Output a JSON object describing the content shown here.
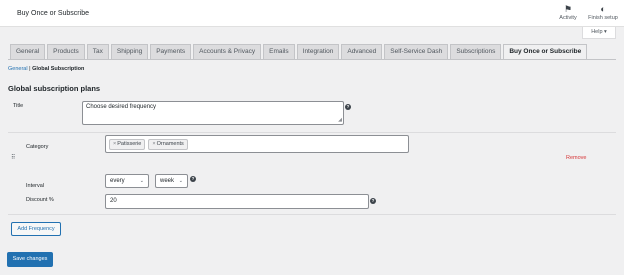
{
  "header": {
    "title": "Buy Once or Subscribe",
    "actions": [
      {
        "label": "Activity",
        "icon": "flag-icon"
      },
      {
        "label": "Finish setup",
        "icon": "half-circle-icon"
      }
    ],
    "help_label": "Help"
  },
  "tabs": [
    {
      "label": "General"
    },
    {
      "label": "Products"
    },
    {
      "label": "Tax"
    },
    {
      "label": "Shipping"
    },
    {
      "label": "Payments"
    },
    {
      "label": "Accounts & Privacy"
    },
    {
      "label": "Emails"
    },
    {
      "label": "Integration"
    },
    {
      "label": "Advanced"
    },
    {
      "label": "Self-Service Dash"
    },
    {
      "label": "Subscriptions"
    },
    {
      "label": "Buy Once or Subscribe",
      "active": true
    }
  ],
  "subnav": {
    "general": "General",
    "separator": " | ",
    "current": "Global Subscription"
  },
  "section_title": "Global subscription plans",
  "form": {
    "title_label": "Title",
    "title_value": "Choose desired frequency",
    "category_label": "Category",
    "categories": [
      "Patisserie",
      "Ornaments"
    ],
    "remove_label": "Remove",
    "interval_label": "Interval",
    "interval_value": "every",
    "period_value": "week",
    "discount_label": "Discount %",
    "discount_value": "20"
  },
  "buttons": {
    "add_frequency": "Add Frequency",
    "save": "Save changes"
  },
  "colors": {
    "accent": "#2271b1",
    "danger": "#d63638",
    "background": "#f0f0f1"
  }
}
